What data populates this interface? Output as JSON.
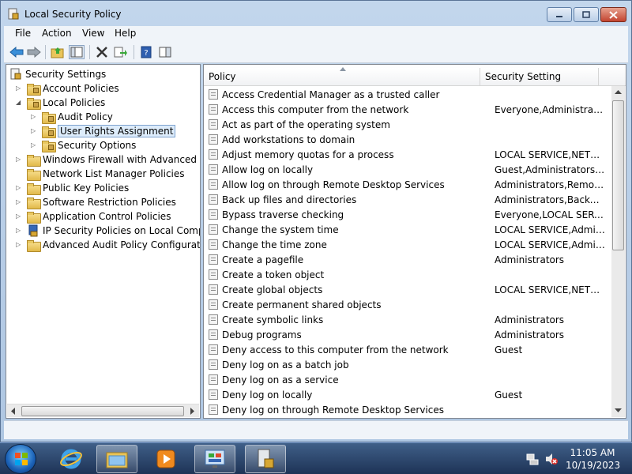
{
  "window": {
    "title": "Local Security Policy"
  },
  "menu": {
    "items": [
      "File",
      "Action",
      "View",
      "Help"
    ]
  },
  "tree": {
    "items": [
      {
        "label": "Security Settings",
        "level": 0
      },
      {
        "label": "Account Policies",
        "level": 1
      },
      {
        "label": "Local Policies",
        "level": 1
      },
      {
        "label": "Audit Policy",
        "level": 2
      },
      {
        "label": "User Rights Assignment",
        "level": 2
      },
      {
        "label": "Security Options",
        "level": 2
      },
      {
        "label": "Windows Firewall with Advanced Secu",
        "level": 1
      },
      {
        "label": "Network List Manager Policies",
        "level": 1
      },
      {
        "label": "Public Key Policies",
        "level": 1
      },
      {
        "label": "Software Restriction Policies",
        "level": 1
      },
      {
        "label": "Application Control Policies",
        "level": 1
      },
      {
        "label": "IP Security Policies on Local Compute",
        "level": 1
      },
      {
        "label": "Advanced Audit Policy Configuration",
        "level": 1
      }
    ]
  },
  "list": {
    "columns": [
      "Policy",
      "Security Setting"
    ],
    "rows": [
      {
        "policy": "Access Credential Manager as a trusted caller",
        "setting": ""
      },
      {
        "policy": "Access this computer from the network",
        "setting": "Everyone,Administrators..."
      },
      {
        "policy": "Act as part of the operating system",
        "setting": ""
      },
      {
        "policy": "Add workstations to domain",
        "setting": ""
      },
      {
        "policy": "Adjust memory quotas for a process",
        "setting": "LOCAL SERVICE,NETWO..."
      },
      {
        "policy": "Allow log on locally",
        "setting": "Guest,Administrators,Us..."
      },
      {
        "policy": "Allow log on through Remote Desktop Services",
        "setting": "Administrators,Remote ..."
      },
      {
        "policy": "Back up files and directories",
        "setting": "Administrators,Backup ..."
      },
      {
        "policy": "Bypass traverse checking",
        "setting": "Everyone,LOCAL SERVIC..."
      },
      {
        "policy": "Change the system time",
        "setting": "LOCAL SERVICE,Admini..."
      },
      {
        "policy": "Change the time zone",
        "setting": "LOCAL SERVICE,Admini..."
      },
      {
        "policy": "Create a pagefile",
        "setting": "Administrators"
      },
      {
        "policy": "Create a token object",
        "setting": ""
      },
      {
        "policy": "Create global objects",
        "setting": "LOCAL SERVICE,NETWO..."
      },
      {
        "policy": "Create permanent shared objects",
        "setting": ""
      },
      {
        "policy": "Create symbolic links",
        "setting": "Administrators"
      },
      {
        "policy": "Debug programs",
        "setting": "Administrators"
      },
      {
        "policy": "Deny access to this computer from the network",
        "setting": "Guest"
      },
      {
        "policy": "Deny log on as a batch job",
        "setting": ""
      },
      {
        "policy": "Deny log on as a service",
        "setting": ""
      },
      {
        "policy": "Deny log on locally",
        "setting": "Guest"
      },
      {
        "policy": "Deny log on through Remote Desktop Services",
        "setting": ""
      }
    ]
  },
  "taskbar": {
    "time": "11:05 AM",
    "date": "10/19/2023"
  }
}
